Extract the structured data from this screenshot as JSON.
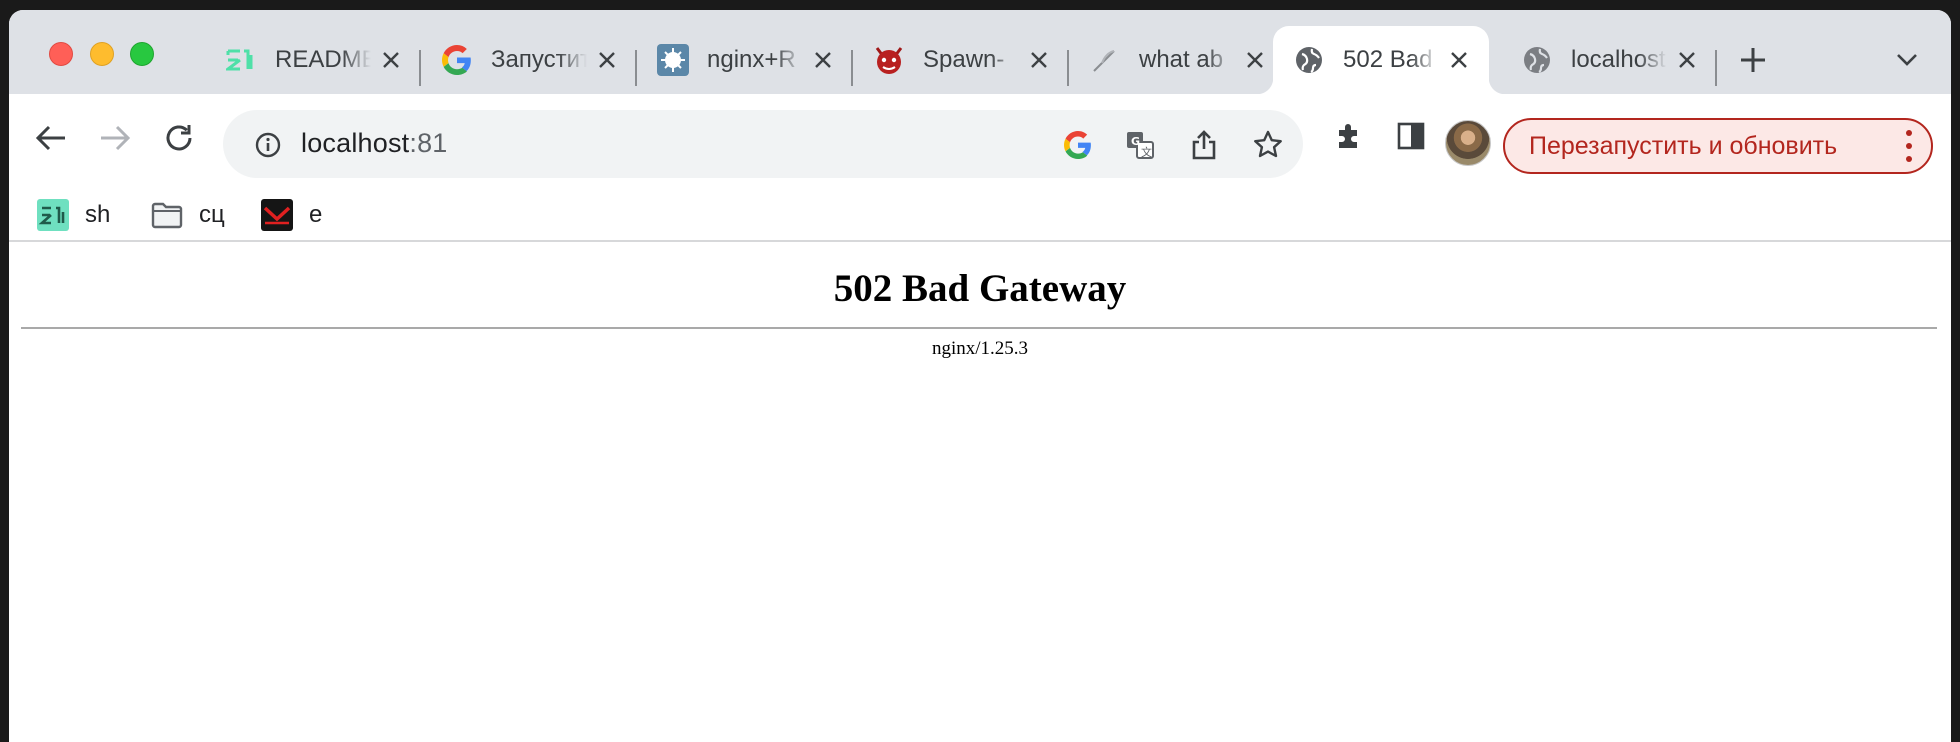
{
  "tabs": [
    {
      "title": "README",
      "icon": "zed-icon",
      "active": false
    },
    {
      "title": "Запустить",
      "icon": "google-icon",
      "active": false
    },
    {
      "title": "nginx+R",
      "icon": "nginx-splash-icon",
      "active": false
    },
    {
      "title": "Spawn-",
      "icon": "devil-icon",
      "active": false
    },
    {
      "title": "what ab",
      "icon": "feather-icon",
      "active": false
    },
    {
      "title": "502 Bad",
      "icon": "globe-icon",
      "active": true
    },
    {
      "title": "localhost",
      "icon": "globe-icon",
      "active": false
    }
  ],
  "omnibox": {
    "host": "localhost",
    "port": ":81"
  },
  "toolbar": {
    "relaunch_label": "Перезапустить и обновить"
  },
  "bookmarks": [
    {
      "label": "sh",
      "icon": "zed-icon"
    },
    {
      "label": "сц",
      "icon": "folder-icon"
    },
    {
      "label": "e",
      "icon": "mail-icon"
    }
  ],
  "page": {
    "heading": "502 Bad Gateway",
    "server": "nginx/1.25.3"
  },
  "colors": {
    "tabstrip": "#dee1e6",
    "relaunch": "#b3261e"
  }
}
